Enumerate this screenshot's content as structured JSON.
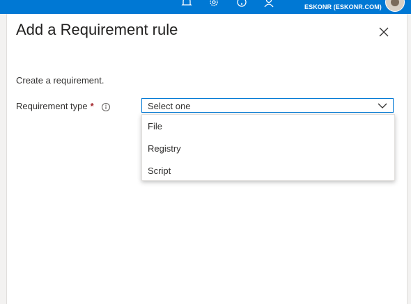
{
  "header": {
    "account_label": "ESKONR (ESKONR.COM)",
    "icons": [
      "notifications-icon",
      "settings-icon",
      "help-icon",
      "feedback-icon",
      "avatar"
    ],
    "accent_color": "#0078d4"
  },
  "panel": {
    "title": "Add a Requirement rule",
    "close_icon": "close-icon",
    "instruction": "Create a requirement.",
    "requirement_type": {
      "label": "Requirement type",
      "required_marker": "*",
      "info_icon": "info-icon",
      "selected_value": "Select one",
      "options": [
        "File",
        "Registry",
        "Script"
      ]
    }
  }
}
